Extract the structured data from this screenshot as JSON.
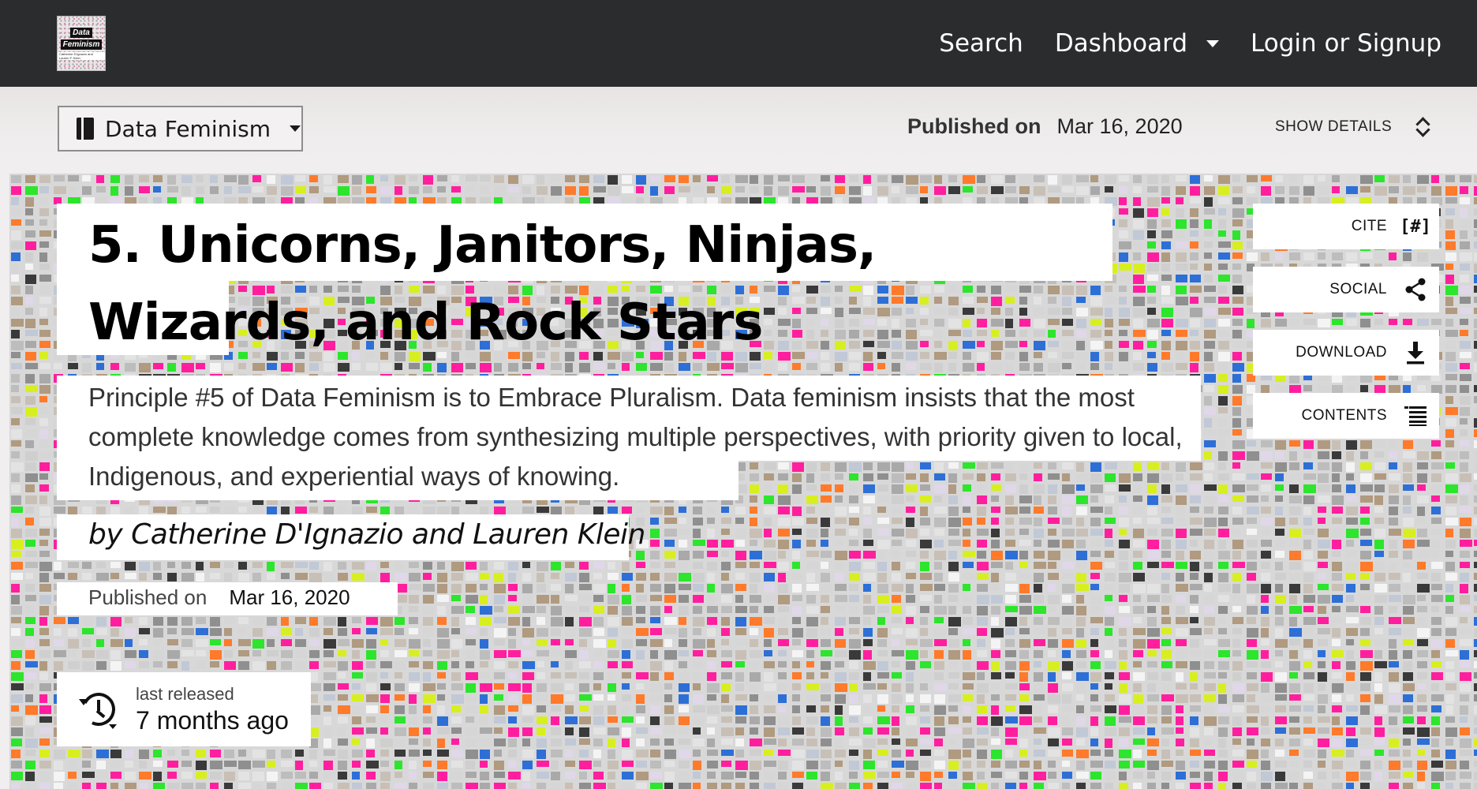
{
  "nav": {
    "logo_title_line1": "Data",
    "logo_title_line2": "Feminism",
    "logo_authors": "Catherine D'Ignazio and Lauren F. Klein",
    "search": "Search",
    "dashboard": "Dashboard",
    "login": "Login or Signup"
  },
  "collection_bar": {
    "collection": "Data Feminism",
    "published_label": "Published on",
    "published_date": "Mar 16, 2020",
    "show_details": "SHOW DETAILS"
  },
  "chapter": {
    "title": "5. Unicorns, Janitors, Ninjas, Wizards, and Rock Stars",
    "description": "Principle #5 of Data Feminism is to Embrace Pluralism. Data feminism insists that the most complete knowledge comes from synthesizing multiple perspectives, with priority given to local, Indigenous, and experiential ways of knowing.",
    "byline": "by Catherine D'Ignazio and Lauren Klein",
    "published_label": "Published on",
    "published_date": "Mar 16, 2020",
    "release_label": "last released",
    "release_value": "7 months ago"
  },
  "actions": [
    {
      "label": "CITE",
      "icon": "[#]"
    },
    {
      "label": "SOCIAL",
      "icon": "share-icon"
    },
    {
      "label": "DOWNLOAD",
      "icon": "download-icon"
    },
    {
      "label": "CONTENTS",
      "icon": "list-icon"
    }
  ],
  "colors": {
    "nav_bg": "#2b2c2e",
    "mosaic_pink": "#ff1f9e",
    "mosaic_green": "#2ce52c",
    "mosaic_yellow": "#d8ef1f"
  }
}
